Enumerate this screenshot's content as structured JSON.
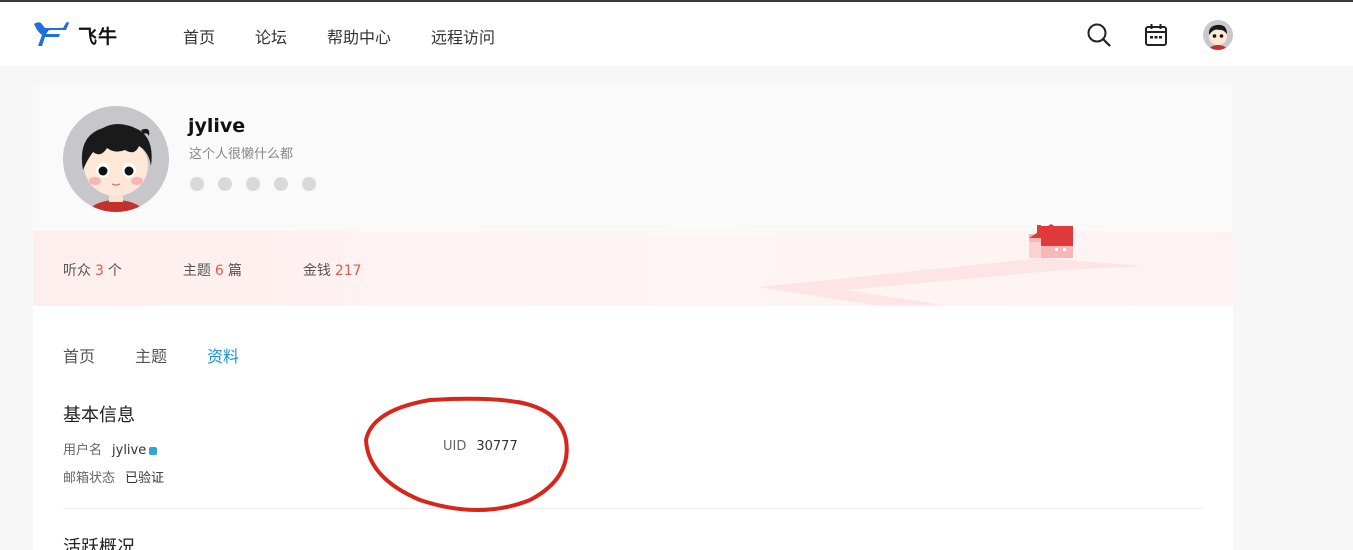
{
  "header": {
    "logo_text": "飞牛",
    "nav": [
      "首页",
      "论坛",
      "帮助中心",
      "远程访问"
    ],
    "icons": [
      "search-icon",
      "calendar-icon",
      "user-avatar"
    ]
  },
  "profile": {
    "username": "jylive",
    "bio": "这个人很懒什么都",
    "social_icons": [
      "social-icon-1",
      "social-icon-2",
      "social-icon-3",
      "social-icon-4",
      "social-icon-5"
    ],
    "stats": {
      "listeners": {
        "label": "听众",
        "value": "3",
        "unit": "个"
      },
      "topics": {
        "label": "主题",
        "value": "6",
        "unit": "篇"
      },
      "money": {
        "label": "金钱",
        "value": "217"
      }
    }
  },
  "tabs": {
    "items": [
      "首页",
      "主题",
      "资料"
    ],
    "active": "资料"
  },
  "basic_info": {
    "title": "基本信息",
    "username_label": "用户名",
    "username_value": "jylive",
    "email_label": "邮箱状态",
    "email_value": "已验证",
    "uid_label": "UID",
    "uid_value": "30777"
  },
  "activity": {
    "title": "活跃概况"
  },
  "colors": {
    "accent": "#1f8fd6",
    "stat_number": "#e05a4f",
    "annotation": "#d9261c"
  }
}
